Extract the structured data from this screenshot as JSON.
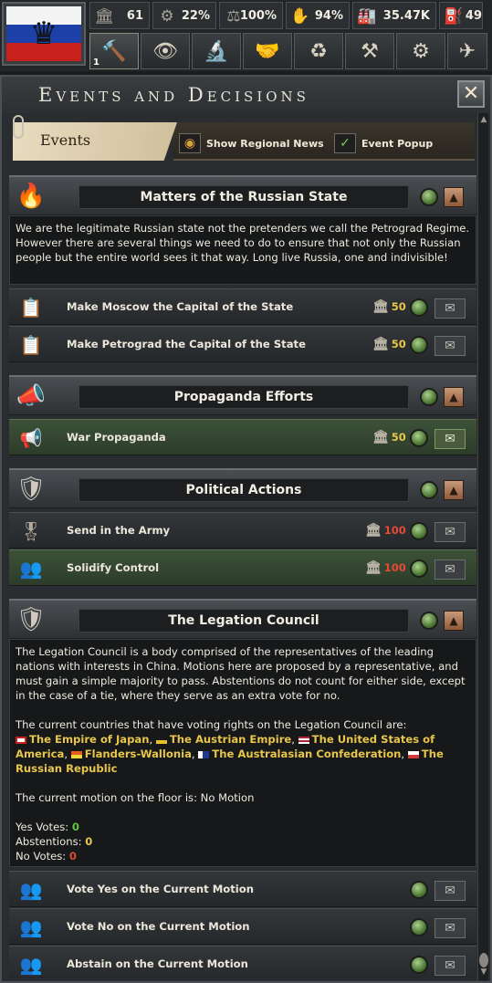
{
  "topbar": {
    "resources": [
      {
        "icon": "political-power-icon",
        "glyph": "🏛",
        "value": "61",
        "width": 66
      },
      {
        "icon": "stability-icon",
        "glyph": "⚙",
        "value": "22%",
        "width": 70
      },
      {
        "icon": "war-support-icon",
        "glyph": "⚖",
        "value": "100%",
        "width": 70
      },
      {
        "icon": "manpower-icon",
        "glyph": "✋",
        "value": "94%",
        "width": 70
      },
      {
        "icon": "factories-icon",
        "glyph": "🏭",
        "value": "35.47K",
        "width": 92
      },
      {
        "icon": "fuel-icon",
        "glyph": "⛽",
        "value": "49",
        "width": 48
      }
    ],
    "actions": [
      {
        "name": "decisions-button",
        "icon": "gavel-icon",
        "glyph": "🔨",
        "badge": "1"
      },
      {
        "name": "intelligence-button",
        "icon": "eye-icon",
        "glyph": "👁",
        "badge": ""
      },
      {
        "name": "research-button",
        "icon": "research-icon",
        "glyph": "🔬",
        "badge": ""
      },
      {
        "name": "diplomacy-button",
        "icon": "handshake-icon",
        "glyph": "🤝",
        "badge": ""
      },
      {
        "name": "trade-button",
        "icon": "trade-icon",
        "glyph": "♻",
        "badge": ""
      },
      {
        "name": "construction-button",
        "icon": "construction-icon",
        "glyph": "⚒",
        "badge": ""
      },
      {
        "name": "production-button",
        "icon": "gear-icon",
        "glyph": "⚙",
        "badge": ""
      },
      {
        "name": "army-button",
        "icon": "tank-icon",
        "glyph": "✈",
        "badge": ""
      }
    ]
  },
  "panel": {
    "title": "Events and Decisions",
    "close": "✕",
    "tab_label": "Events",
    "show_regional_news": "Show Regional News",
    "event_popup": "Event Popup",
    "event_popup_check": "✓",
    "regional_check": "◉"
  },
  "categories": {
    "russian_state": {
      "title": "Matters of the Russian State",
      "glyph": "🔥",
      "description": "We are the legitimate Russian state not the pretenders we call the Petrograd Regime. However there are several things we need to do to ensure that not only the Russian people but the entire world sees it that way. Long live Russia, one and indivisible!",
      "decisions": [
        {
          "label": "Make Moscow the Capital of the State",
          "cost": "50",
          "glyph": "📋"
        },
        {
          "label": "Make Petrograd the Capital of the State",
          "cost": "50",
          "glyph": "📋"
        }
      ]
    },
    "propaganda": {
      "title": "Propaganda Efforts",
      "glyph": "📣",
      "decisions": [
        {
          "label": "War Propaganda",
          "cost": "50",
          "glyph": "📢"
        }
      ]
    },
    "political": {
      "title": "Political Actions",
      "glyph": "🛡",
      "decisions": [
        {
          "label": "Send in the Army",
          "cost": "100",
          "glyph": "🎖"
        },
        {
          "label": "Solidify Control",
          "cost": "100",
          "glyph": "👥"
        }
      ]
    },
    "legation": {
      "title": "The Legation Council",
      "glyph": "🛡",
      "description": "The Legation Council is a body comprised of the representatives of the leading nations with interests in China. Motions here are proposed by a representative, and must gain a simple majority to pass. Abstentions do not count for either side, except in the case of a tie, where they serve as an extra vote for no.",
      "countries_intro": "The current countries that have voting rights on the Legation Council are:",
      "countries": [
        {
          "name": "The Empire of Japan",
          "flag": "#ffffff",
          "sep": ","
        },
        {
          "name": "The Austrian Empire",
          "flag": "#e8c02a",
          "sep": ","
        },
        {
          "name": "The United States of America",
          "flag": "#b22234",
          "sep": ","
        },
        {
          "name": "Flanders-Wallonia",
          "flag": "#e85a1a",
          "sep": ","
        },
        {
          "name": "The Australasian Confederation",
          "flag": "#1f3b8c",
          "sep": ","
        },
        {
          "name": "The Russian Republic",
          "flag": "#d23b3b",
          "sep": ""
        }
      ],
      "motion_label": "The current motion on the floor is: No Motion",
      "yes_label": "Yes Votes:",
      "yes_value": "0",
      "abst_label": "Abstentions:",
      "abst_value": "0",
      "no_label": "No Votes:",
      "no_value": "0",
      "decisions": [
        {
          "label": "Vote Yes on the Current Motion",
          "glyph": "👥"
        },
        {
          "label": "Vote No on the Current Motion",
          "glyph": "👥"
        },
        {
          "label": "Abstain on the Current Motion",
          "glyph": "👥"
        }
      ]
    }
  },
  "colors": {
    "cost_yellow": "#e8c64a",
    "cost_red": "#e44a35",
    "green_row": "#3d5138"
  }
}
